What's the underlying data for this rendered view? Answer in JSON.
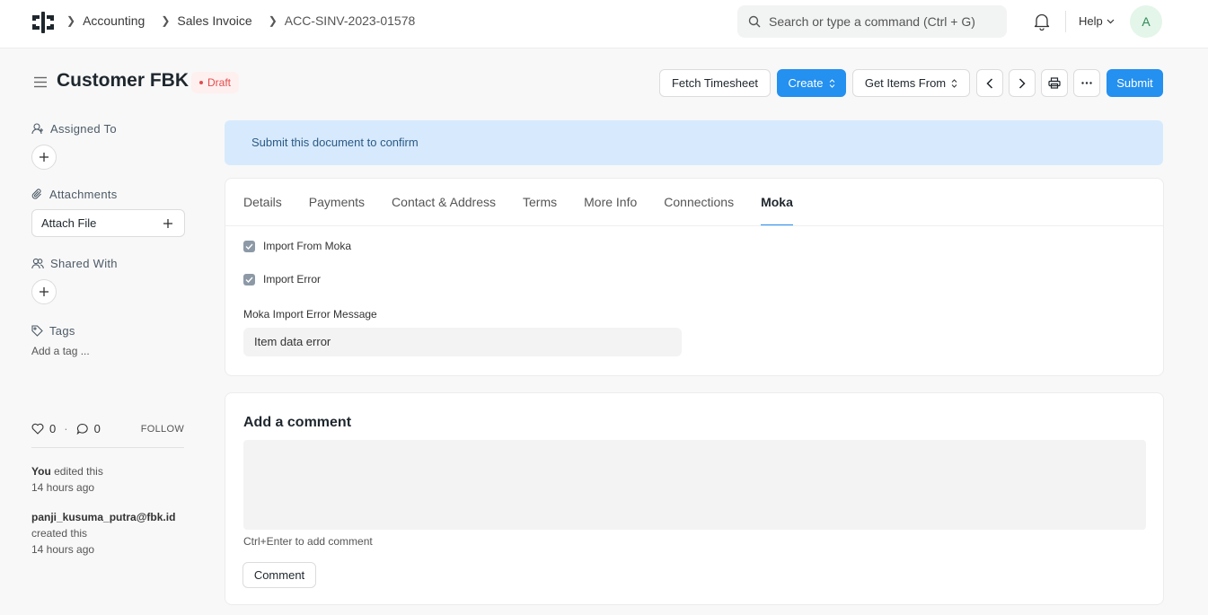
{
  "navbar": {
    "breadcrumbs": [
      "Accounting",
      "Sales Invoice",
      "ACC-SINV-2023-01578"
    ],
    "search_placeholder": "Search or type a command (Ctrl + G)",
    "help_label": "Help",
    "avatar_initial": "A"
  },
  "page": {
    "title": "Customer FBK",
    "status": "Draft",
    "buttons": {
      "fetch_timesheet": "Fetch Timesheet",
      "create": "Create",
      "get_items_from": "Get Items From",
      "submit": "Submit"
    }
  },
  "sidebar": {
    "assigned_to": "Assigned To",
    "attachments": "Attachments",
    "attach_file": "Attach File",
    "shared_with": "Shared With",
    "tags": "Tags",
    "add_tag": "Add a tag ...",
    "likes": "0",
    "comments_count": "0",
    "follow": "FOLLOW",
    "activity": [
      {
        "actor": "You",
        "action": "edited this",
        "time": "14 hours ago"
      },
      {
        "actor": "panji_kusuma_putra@fbk.id",
        "action": "created this",
        "time": "14 hours ago"
      }
    ]
  },
  "alert": "Submit this document to confirm",
  "tabs": [
    "Details",
    "Payments",
    "Contact & Address",
    "Terms",
    "More Info",
    "Connections",
    "Moka"
  ],
  "active_tab": "Moka",
  "moka": {
    "import_from_moka": {
      "label": "Import From Moka",
      "checked": true
    },
    "import_error": {
      "label": "Import Error",
      "checked": true
    },
    "error_message_label": "Moka Import Error Message",
    "error_message_value": "Item data error"
  },
  "comment": {
    "title": "Add a comment",
    "hint": "Ctrl+Enter to add comment",
    "button": "Comment"
  },
  "colors": {
    "primary": "#2490ef",
    "alert_bg": "#d7eafd",
    "draft": "#e24c4c"
  }
}
